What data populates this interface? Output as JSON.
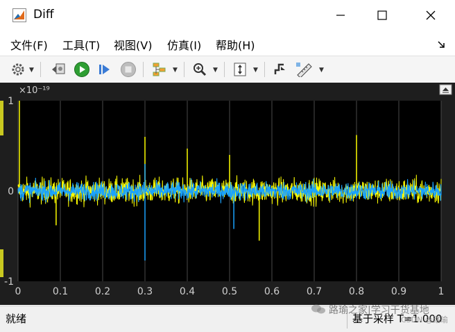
{
  "window": {
    "title": "Diff"
  },
  "menu": {
    "items": [
      {
        "label": "文件(F)"
      },
      {
        "label": "工具(T)"
      },
      {
        "label": "视图(V)"
      },
      {
        "label": "仿真(I)"
      },
      {
        "label": "帮助(H)"
      }
    ]
  },
  "toolbar": {
    "icons": [
      "gear-icon",
      "highlight-model-icon",
      "run-icon",
      "step-forward-icon",
      "stop-icon",
      "signal-selector-icon",
      "zoom-icon",
      "fit-axes-icon",
      "triggers-icon",
      "measurements-icon"
    ]
  },
  "plot": {
    "exponent_label": "×10⁻¹⁹",
    "y_ticks": [
      "1",
      "0",
      "-1"
    ],
    "x_ticks": [
      "0",
      "0.1",
      "0.2",
      "0.3",
      "0.4",
      "0.5",
      "0.6",
      "0.7",
      "0.8",
      "0.9",
      "1"
    ],
    "background": "#000000",
    "grid_color": "#4a4a4a",
    "series_colors": [
      "#ffff00",
      "#1aa3ff"
    ]
  },
  "chart_data": {
    "type": "line",
    "title": "",
    "xlabel": "",
    "ylabel": "",
    "xlim": [
      0,
      1
    ],
    "ylim": [
      -1,
      1
    ],
    "y_scale_exponent": -19,
    "grid": true,
    "series": [
      {
        "color": "#ffff00",
        "approx_band": [
          -0.25,
          0.25
        ],
        "notable_spikes": [
          {
            "x": 0.0,
            "y": 1.0
          },
          {
            "x": 0.3,
            "y": 0.6
          },
          {
            "x": 0.4,
            "y": 0.47
          },
          {
            "x": 0.5,
            "y": 0.4
          },
          {
            "x": 0.8,
            "y": 0.62
          },
          {
            "x": 0.09,
            "y": -0.38
          },
          {
            "x": 0.57,
            "y": -0.55
          }
        ]
      },
      {
        "color": "#1aa3ff",
        "approx_band": [
          -0.18,
          0.18
        ],
        "notable_spikes": [
          {
            "x": 0.3,
            "y": -0.77
          },
          {
            "x": 0.51,
            "y": -0.42
          },
          {
            "x": 0.3,
            "y": 0.3
          }
        ]
      }
    ]
  },
  "status": {
    "left": "就绪",
    "right": "基于采样",
    "right_value": "T=1.000"
  },
  "watermark": {
    "text": "路瑜之家|学习干货基地",
    "sub": "CSDN @路瑜"
  }
}
